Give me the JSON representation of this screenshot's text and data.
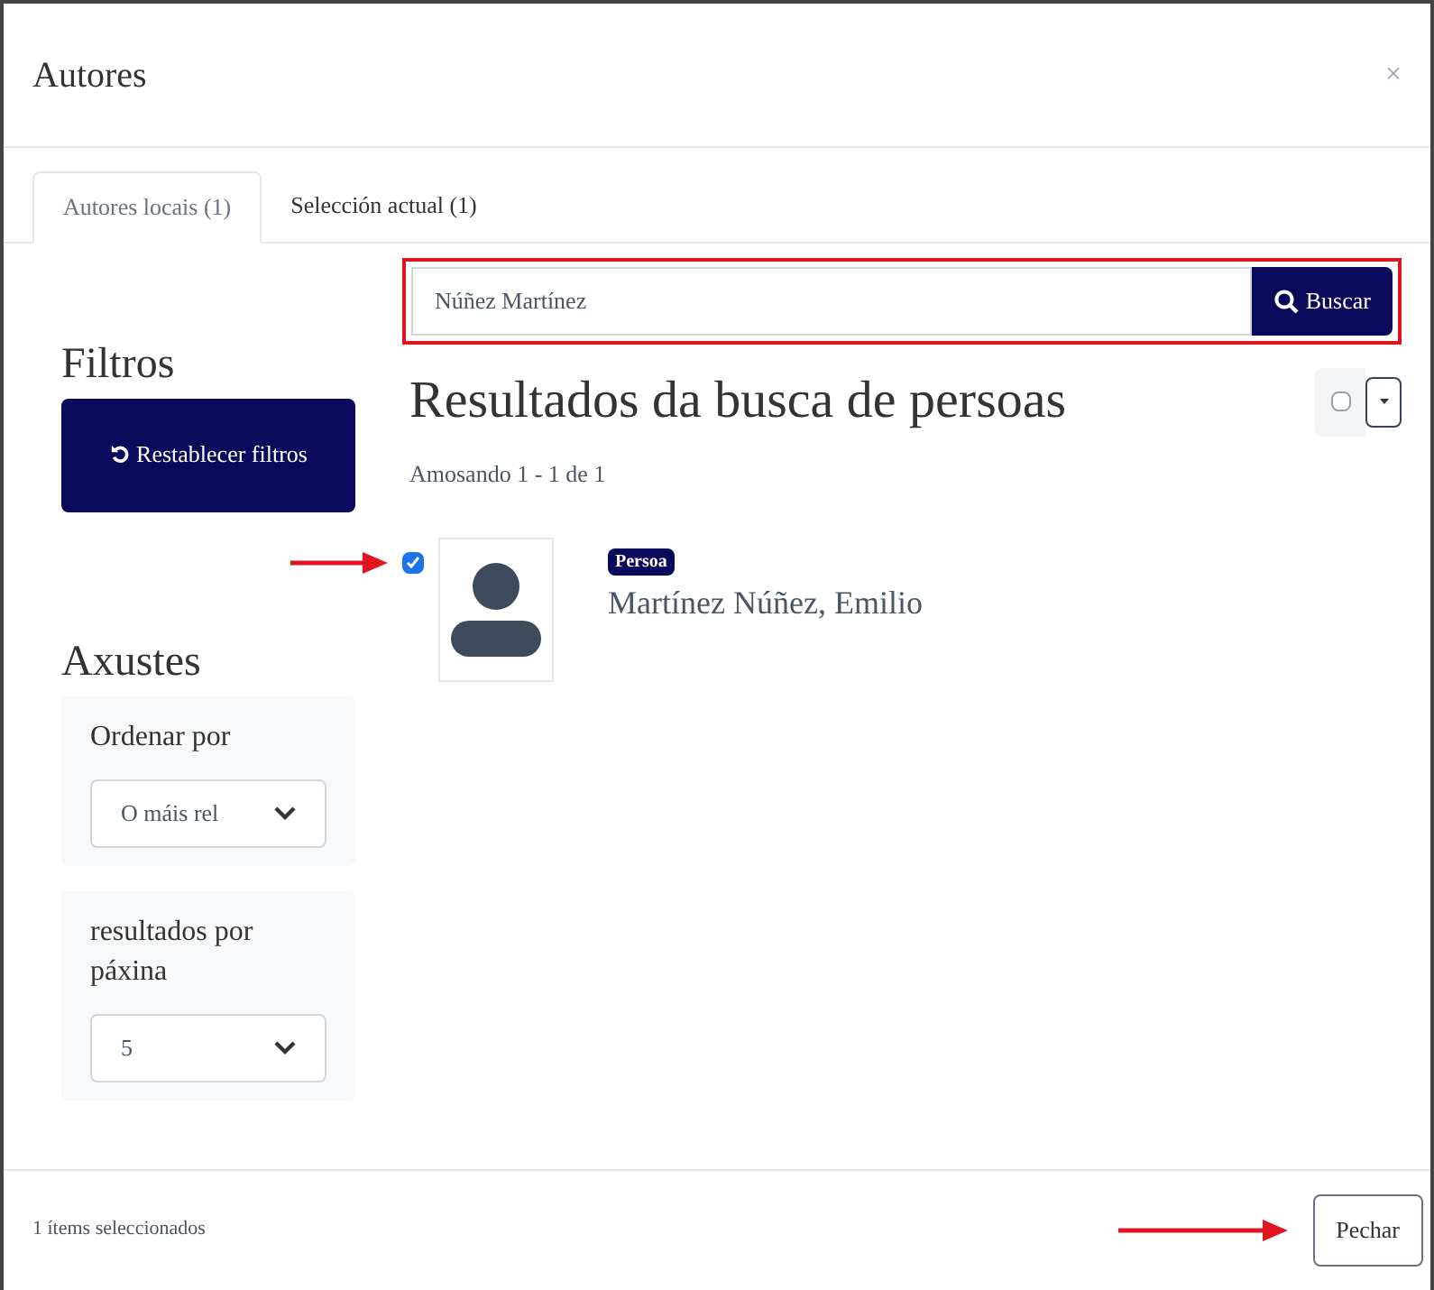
{
  "dialog": {
    "title": "Autores",
    "close": "×"
  },
  "tabs": [
    {
      "label": "Autores locais (1)",
      "selected": true
    },
    {
      "label": "Selección actual (1)",
      "selected": false
    }
  ],
  "search": {
    "value": "Núñez Martínez",
    "button": "Buscar",
    "highlighted": true
  },
  "filters": {
    "heading": "Filtros",
    "reset_button": "Restablecer filtros"
  },
  "settings": {
    "heading": "Axustes",
    "groups": [
      {
        "label": "Ordenar por",
        "value": "O máis rel"
      },
      {
        "label": "resultados por páxina",
        "value": "5"
      }
    ]
  },
  "results": {
    "heading": "Resultados da busca de persoas",
    "select_all_checked": false,
    "count": "Amosando 1 - 1 de 1",
    "items": [
      {
        "checked": true,
        "badge": "Persoa",
        "name": "Martínez Núñez, Emilio",
        "pointed": true
      }
    ]
  },
  "footer": {
    "status": "1 ítems seleccionados",
    "close_button": "Pechar",
    "pointed": true
  }
}
